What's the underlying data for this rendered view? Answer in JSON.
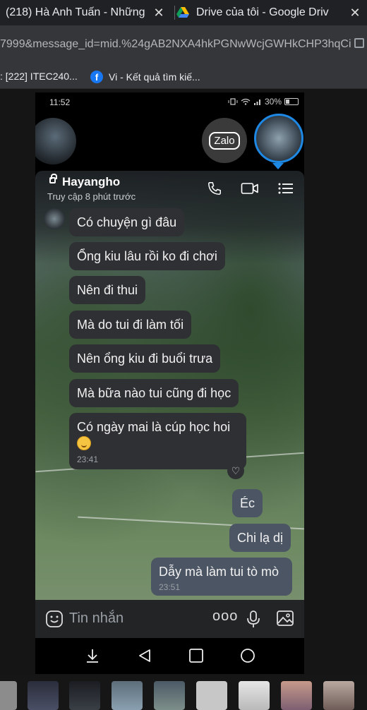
{
  "browser": {
    "tabs": [
      {
        "title": "(218) Hà Anh Tuấn - Những"
      },
      {
        "title": "Drive của tôi - Google Driv"
      }
    ],
    "close_glyph": "✕",
    "url": "7999&message_id=mid.%24gAB2NXA4hkPGNwWcjGWHkCHP3hqCi",
    "bookmarks": [
      {
        "label": ": [222] ITEC240..."
      },
      {
        "label": "Vi - Kết quả tìm kiế..."
      }
    ]
  },
  "phone": {
    "status": {
      "time": "11:52",
      "battery": "30%"
    },
    "bubbles": {
      "zalo_label": "Zalo"
    },
    "chat": {
      "contact_name": "Hayangho",
      "last_seen": "Truy cập 8 phút trước",
      "messages_in": [
        {
          "text": "Có chuyện gì đâu"
        },
        {
          "text": "Ổng kiu lâu rồi ko đi chơi"
        },
        {
          "text": "Nên đi thui"
        },
        {
          "text": "Mà do tui đi làm tối"
        },
        {
          "text": "Nên ổng kiu đi buổi trưa"
        },
        {
          "text": "Mà bữa nào tui cũng đi học"
        },
        {
          "text": "Có ngày mai là cúp học hoi",
          "time": "23:41"
        }
      ],
      "messages_out": [
        {
          "text": "Éc"
        },
        {
          "text": "Chi lạ dị"
        },
        {
          "text": "Dẫy mà làm tui tò mò",
          "time": "23:51"
        }
      ],
      "reaction_icon": "heart-icon",
      "composer_placeholder": "Tin nhắn",
      "more_glyph": "ooo"
    }
  },
  "colors": {
    "messenger_blue": "#1e88e5",
    "incoming_bubble": "#2f3033",
    "outgoing_bubble": "#4b5563"
  }
}
